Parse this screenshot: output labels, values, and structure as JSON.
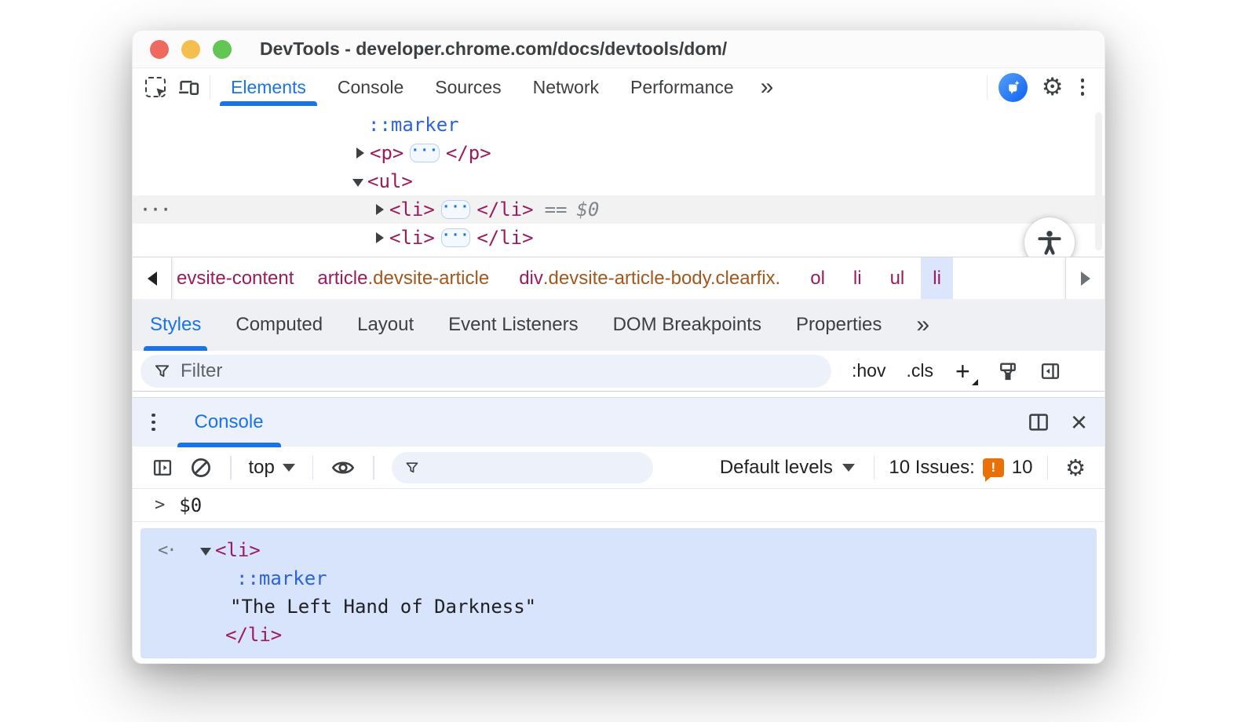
{
  "window": {
    "title": "DevTools - developer.chrome.com/docs/devtools/dom/"
  },
  "main_tabs": {
    "items": [
      "Elements",
      "Console",
      "Sources",
      "Network",
      "Performance"
    ],
    "active": "Elements",
    "more": "»"
  },
  "elements_panel": {
    "gutter_dots": "···",
    "ellipsis": "···",
    "pseudo_row": "::marker",
    "p_open": "<p>",
    "p_close": "</p>",
    "ul_open": "<ul>",
    "li1_open": "<li>",
    "li1_close": "</li>",
    "li1_eq": "==",
    "li1_val": "$0",
    "li2_open": "<li>",
    "li2_close": "</li>"
  },
  "breadcrumbs": {
    "c1_tag": "evsite-content",
    "c2_tag": "article",
    "c2_cls": ".devsite-article",
    "c3_tag": "div",
    "c3_cls": ".devsite-article-body.clearfix.",
    "c4_tag": "ol",
    "c5_tag": "li",
    "c6_tag": "ul",
    "c7_tag": "li"
  },
  "sidebar_tabs": {
    "items": [
      "Styles",
      "Computed",
      "Layout",
      "Event Listeners",
      "DOM Breakpoints",
      "Properties"
    ],
    "active": "Styles",
    "more": "»"
  },
  "styles_toolbar": {
    "filter_placeholder": "Filter",
    "pseudo_toggle": ":hov",
    "class_toggle": ".cls",
    "plus": "+"
  },
  "drawer": {
    "tab": "Console",
    "context": "top",
    "levels": "Default levels",
    "issues_label": "10 Issues:",
    "issues_bang": "!",
    "issues_count": "10",
    "prompt": ">",
    "expression": "$0",
    "result_marker": "<·",
    "result_open": "<li>",
    "result_pseudo": "::marker",
    "result_string": "\"The Left Hand of Darkness\"",
    "result_close": "</li>"
  },
  "icons": {
    "inspect": "inspect-cursor",
    "device": "device-toolbar",
    "ai": "ai-assistance",
    "settings": "gear",
    "menu": "kebab",
    "clear": "block-circle",
    "eye": "live-expression",
    "filter": "funnel",
    "brush": "brush",
    "dock": "panel-toggle",
    "split": "split-panel",
    "close": "close-x",
    "accessibility": "accessibility-person"
  },
  "colors": {
    "accent": "#1a73e8",
    "tag_token": "#9b1b5c",
    "class_token": "#a3571c",
    "pseudo_token": "#2b63d9",
    "issues_orange": "#e8710a",
    "result_highlight": "#d8e3fc",
    "crumb_selected": "#dbe5fb",
    "row_highlight": "#f2f2f2"
  }
}
